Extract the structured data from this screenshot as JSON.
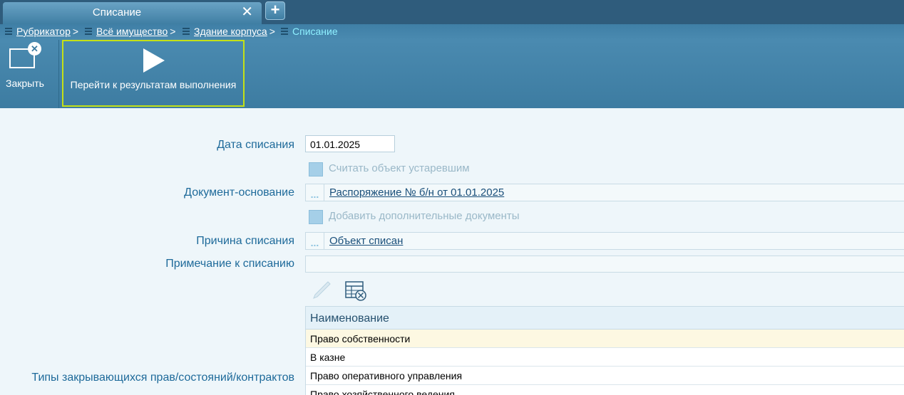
{
  "tab": {
    "title": "Списание"
  },
  "breadcrumb": [
    {
      "label": "Рубрикатор"
    },
    {
      "label": "Всё имущество"
    },
    {
      "label": "Здание корпуса"
    },
    {
      "label": "Списание"
    }
  ],
  "toolbar": {
    "close_label": "Закрыть",
    "run_label": "Перейти к результатам выполнения"
  },
  "form": {
    "date": {
      "label": "Дата списания",
      "value": "01.01.2025"
    },
    "obsolete": {
      "label": "Считать объект устаревшим",
      "checked": false
    },
    "document": {
      "label": "Документ-основание",
      "value": "Распоряжение № б/н от 01.01.2025"
    },
    "extra_docs": {
      "label": "Добавить дополнительные документы",
      "checked": false
    },
    "reason": {
      "label": "Причина списания",
      "value": "Объект списан"
    },
    "note": {
      "label": "Примечание к списанию",
      "value": ""
    },
    "rights": {
      "label": "Типы закрывающихся прав/состояний/контрактов",
      "column": "Наименование",
      "rows": [
        "Право собственности",
        "В казне",
        "Право оперативного управления",
        "Право хозяйственного ведения"
      ]
    }
  },
  "colors": {
    "accent": "#3d7ca1",
    "label": "#1e6a9a",
    "highlight": "#c4e016"
  },
  "icons": {
    "edit": "pencil-icon",
    "table_delete": "table-delete-icon"
  }
}
